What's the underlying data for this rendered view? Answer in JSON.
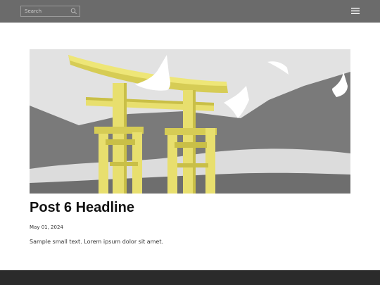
{
  "header": {
    "search": {
      "placeholder": "Search",
      "value": ""
    },
    "search_icon": "search-icon",
    "menu_icon": "hamburger-menu-icon"
  },
  "post": {
    "image": "torii-gate-with-birds-illustration",
    "headline": "Post 6 Headline",
    "date": "May 01, 2024",
    "excerpt": "Sample small text. Lorem ipsum dolor sit amet."
  },
  "colors": {
    "topbar": "#6b6b6b",
    "footer": "#2b2b2b",
    "gate": "#e8df6e",
    "mountains": "#7a7a7a"
  }
}
